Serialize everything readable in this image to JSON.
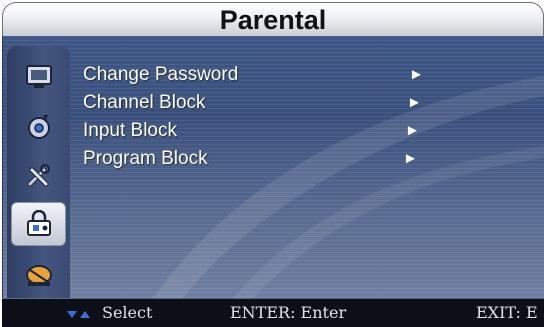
{
  "header": {
    "title": "Parental"
  },
  "sidebar": {
    "items": [
      {
        "icon": "tv-screen-icon",
        "active": false
      },
      {
        "icon": "sound-icon",
        "active": false
      },
      {
        "icon": "tools-icon",
        "active": false
      },
      {
        "icon": "lock-icon",
        "active": true
      },
      {
        "icon": "satellite-dish-icon",
        "active": false
      }
    ]
  },
  "menu": {
    "items": [
      {
        "label": "Change Password",
        "arrow": "►"
      },
      {
        "label": "Channel Block",
        "arrow": "►"
      },
      {
        "label": "Input Block",
        "arrow": "►"
      },
      {
        "label": "Program Block",
        "arrow": "►"
      }
    ]
  },
  "footer": {
    "select_label": "Select",
    "enter_label": "ENTER: Enter",
    "exit_label": "EXIT: E"
  },
  "colors": {
    "panel_blue": "#3f5786",
    "header_silver": "#eef0f4",
    "footer_black": "#0c0f18",
    "arrow_blue": "#3b6fd6"
  }
}
